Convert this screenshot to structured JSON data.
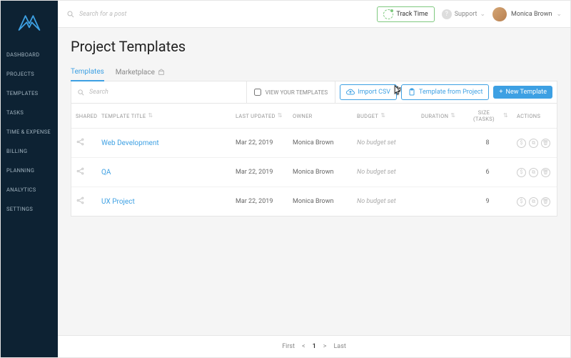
{
  "topbar": {
    "search_placeholder": "Search for a post",
    "track_time_label": "Track Time",
    "support_label": "Support",
    "user_name": "Monica Brown"
  },
  "sidebar": {
    "items": [
      "DASHBOARD",
      "PROJECTS",
      "TEMPLATES",
      "TASKS",
      "TIME & EXPENSE",
      "BILLING",
      "PLANNING",
      "ANALYTICS",
      "SETTINGS"
    ]
  },
  "page": {
    "title": "Project Templates",
    "tabs": {
      "templates": "Templates",
      "marketplace": "Marketplace"
    }
  },
  "toolbar": {
    "search_placeholder": "Search",
    "view_your_templates": "VIEW YOUR TEMPLATES",
    "import_csv": "Import CSV",
    "template_from_project": "Template from Project",
    "new_template": "New Template"
  },
  "columns": {
    "shared": "SHARED",
    "title": "TEMPLATE TITLE",
    "updated": "LAST UPDATED",
    "owner": "OWNER",
    "budget": "BUDGET",
    "duration": "DURATION",
    "size": "SIZE (TASKS)",
    "actions": "ACTIONS"
  },
  "rows": [
    {
      "title": "Web Development",
      "updated": "Mar 22, 2019",
      "owner": "Monica Brown",
      "budget": "No budget set",
      "size": "8"
    },
    {
      "title": "QA",
      "updated": "Mar 22, 2019",
      "owner": "Monica Brown",
      "budget": "No budget set",
      "size": "6"
    },
    {
      "title": "UX Project",
      "updated": "Mar 22, 2019",
      "owner": "Monica Brown",
      "budget": "No budget set",
      "size": "9"
    }
  ],
  "pager": {
    "first": "First",
    "last": "Last",
    "current": "1"
  }
}
